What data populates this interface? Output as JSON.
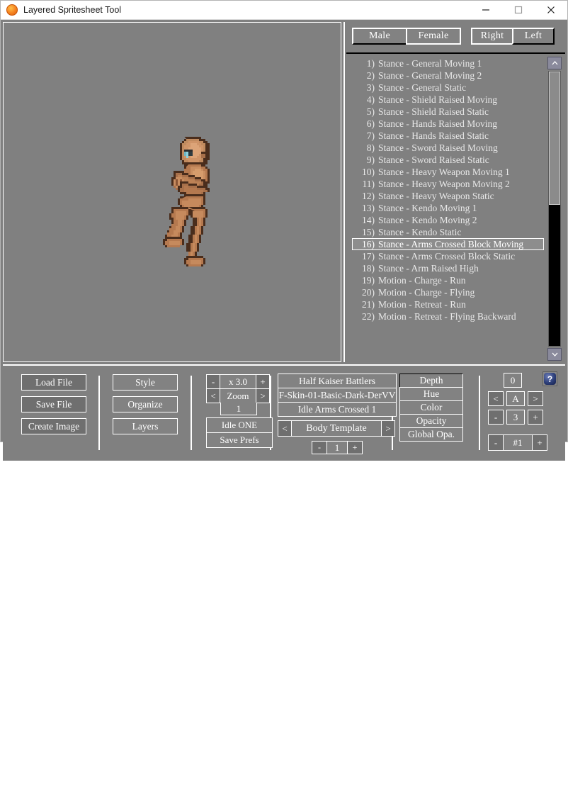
{
  "window": {
    "title": "Layered Spritesheet Tool",
    "app_icon": "sun-orange-icon",
    "controls": {
      "minimize": "minimize-icon",
      "maximize": "maximize-icon",
      "close": "close-icon"
    }
  },
  "canvas": {
    "background_color": "#808080",
    "sprite_description": "pixel-art humanoid character, arms crossed block stance"
  },
  "gender_side": {
    "gender": [
      {
        "label": "Male",
        "selected": true
      },
      {
        "label": "Female",
        "selected": false
      }
    ],
    "facing": [
      {
        "label": "Right",
        "selected": true
      },
      {
        "label": "Left",
        "selected": false
      }
    ]
  },
  "animation_list": {
    "selected_index": 16,
    "items": [
      {
        "num": "1)",
        "label": "Stance - General Moving 1"
      },
      {
        "num": "2)",
        "label": "Stance - General Moving 2"
      },
      {
        "num": "3)",
        "label": "Stance - General Static"
      },
      {
        "num": "4)",
        "label": "Stance - Shield Raised Moving"
      },
      {
        "num": "5)",
        "label": "Stance - Shield Raised Static"
      },
      {
        "num": "6)",
        "label": "Stance - Hands Raised Moving"
      },
      {
        "num": "7)",
        "label": "Stance - Hands Raised Static"
      },
      {
        "num": "8)",
        "label": "Stance - Sword Raised Moving"
      },
      {
        "num": "9)",
        "label": "Stance - Sword Raised Static"
      },
      {
        "num": "10)",
        "label": "Stance - Heavy Weapon Moving 1"
      },
      {
        "num": "11)",
        "label": "Stance - Heavy Weapon Moving 2"
      },
      {
        "num": "12)",
        "label": "Stance - Heavy Weapon Static"
      },
      {
        "num": "13)",
        "label": "Stance - Kendo Moving 1"
      },
      {
        "num": "14)",
        "label": "Stance - Kendo Moving 2"
      },
      {
        "num": "15)",
        "label": "Stance - Kendo Static"
      },
      {
        "num": "16)",
        "label": "Stance - Arms Crossed Block Moving"
      },
      {
        "num": "17)",
        "label": "Stance - Arms Crossed Block Static"
      },
      {
        "num": "18)",
        "label": "Stance - Arm Raised High"
      },
      {
        "num": "19)",
        "label": "Motion - Charge - Run"
      },
      {
        "num": "20)",
        "label": "Motion - Charge - Flying"
      },
      {
        "num": "21)",
        "label": "Motion - Retreat - Run"
      },
      {
        "num": "22)",
        "label": "Motion - Retreat - Flying Backward"
      }
    ],
    "scrollbar": {
      "up_arrow": "chevron-up-icon",
      "down_arrow": "chevron-down-icon"
    }
  },
  "toolbar": {
    "file_buttons": [
      {
        "label": "Load File"
      },
      {
        "label": "Save File"
      },
      {
        "label": "Create Image"
      }
    ],
    "edit_buttons": [
      {
        "label": "Style"
      },
      {
        "label": "Organize"
      },
      {
        "label": "Layers"
      }
    ],
    "zoom": {
      "minus": "-",
      "value": "x 3.0",
      "plus": "+",
      "prev": "<",
      "label": "Zoom",
      "next": ">",
      "frame": "1",
      "idle_button": "Idle ONE",
      "save_prefs_button": "Save Prefs"
    },
    "asset": {
      "set_name": "Half Kaiser Battlers",
      "skin_name": "F-Skin-01-Basic-Dark-DerVV",
      "pose_name": "Idle Arms Crossed 1",
      "template_prev": "<",
      "template_label": "Body Template",
      "template_next": ">",
      "step_minus": "-",
      "step_value": "1",
      "step_plus": "+"
    },
    "properties": [
      {
        "label": "Depth",
        "selected": true
      },
      {
        "label": "Hue",
        "selected": false
      },
      {
        "label": "Color",
        "selected": false
      },
      {
        "label": "Opacity",
        "selected": false
      },
      {
        "label": "Global Opa.",
        "selected": false
      }
    ],
    "numeric": {
      "top_value": "0",
      "prev": "<",
      "letter_value": "A",
      "next": ">",
      "minus": "-",
      "mid_value": "3",
      "plus": "+",
      "layer_minus": "-",
      "layer_value": "#1",
      "layer_plus": "+"
    },
    "help_button": "?"
  },
  "colors": {
    "panel_bg": "#808080",
    "button_bg": "#828282",
    "button_bg_dark": "#6f6f6f",
    "button_border": "#ffffff",
    "text": "#ffffff",
    "titlebar_bg": "#ffffff",
    "scroll_track": "#000000",
    "help_blue": "#2d3f7a"
  }
}
